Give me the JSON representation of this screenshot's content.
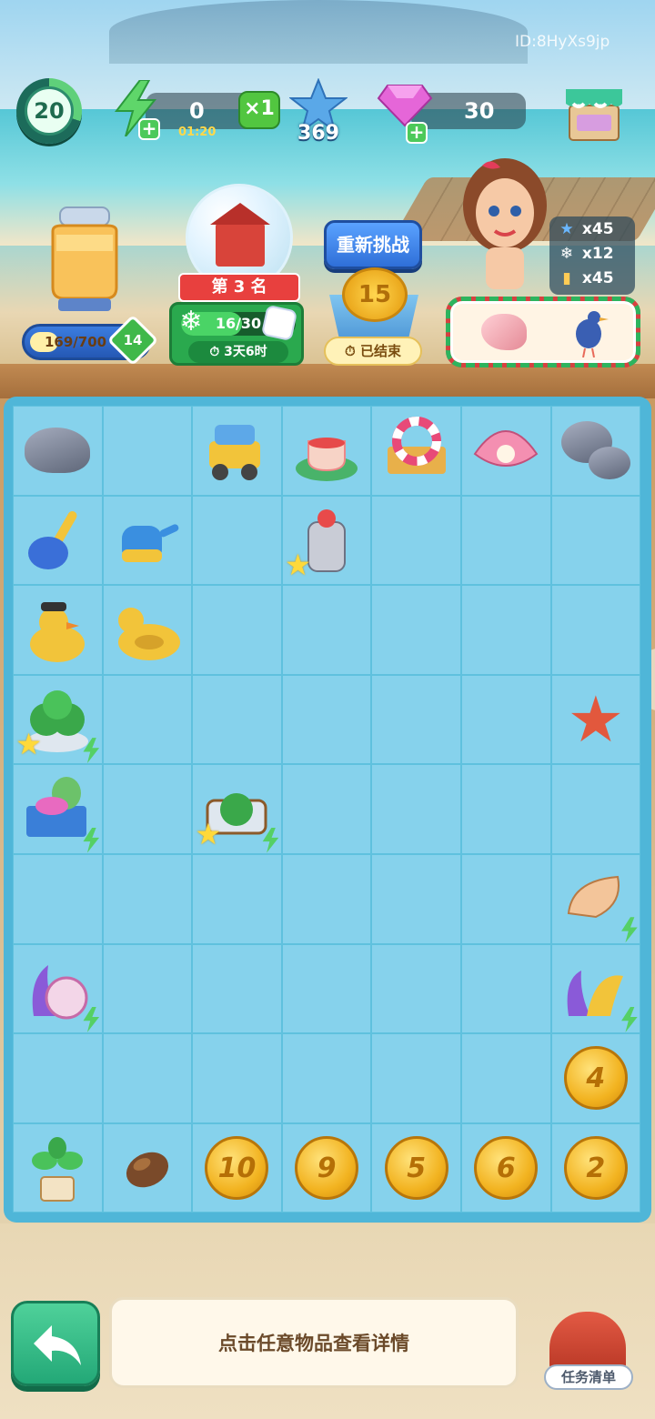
{
  "user_id": "ID:8HyXs9jp",
  "hud": {
    "level": "20",
    "energy_value": "0",
    "energy_timer": "01:20",
    "energy_multiplier": "×1",
    "stars": "369",
    "gems": "30"
  },
  "event": {
    "jar_progress": "169/700",
    "jar_progress_fraction": 0.24,
    "jar_level": "14",
    "rank_label": "第 3 名",
    "rank_progress": "16/30",
    "rank_progress_fraction": 0.53,
    "rank_timer": "3天6时",
    "retry_label": "重新挑战",
    "coin_value": "15",
    "ended_label": "已结束"
  },
  "rewards": {
    "stars": "x45",
    "snowflakes": "x12",
    "jars": "x45"
  },
  "colors": {
    "accent_green": "#2aa94e",
    "retry_blue": "#2f6fd8",
    "coin_gold": "#f2b320",
    "board_cell": "#86d2ec"
  },
  "board": {
    "rows": [
      [
        "rock-icon",
        "",
        "sand-truck-icon",
        "tea-icon",
        "life-ring-cart-icon",
        "pearl-shell-icon",
        "rocks-icon"
      ],
      [
        "shovel-icon",
        "watering-can-icon",
        "",
        "juicer-icon",
        "",
        "",
        ""
      ],
      [
        "rubber-duck-hat-icon",
        "duck-float-icon",
        "",
        "",
        "",
        "",
        ""
      ],
      [
        "cactus-pot-icon",
        "",
        "",
        "",
        "",
        "",
        "starfish-icon"
      ],
      [
        "surf-basket-icon",
        "",
        "watermelon-cart-icon",
        "",
        "",
        "",
        ""
      ],
      [
        "",
        "",
        "",
        "",
        "",
        "",
        "conch-shell-icon"
      ],
      [
        "coral-shell-icon",
        "",
        "",
        "",
        "",
        "",
        "coral-icon"
      ],
      [
        "",
        "",
        "",
        "",
        "",
        "",
        "coin-4"
      ],
      [
        "potted-plant-icon",
        "seed-icon",
        "coin-10",
        "coin-9",
        "coin-5",
        "coin-6",
        "coin-2"
      ]
    ],
    "coins": {
      "coin-4": "4",
      "coin-10": "10",
      "coin-9": "9",
      "coin-5": "5",
      "coin-6": "6",
      "coin-2": "2"
    }
  },
  "bottom": {
    "hint": "点击任意物品查看详情",
    "task_label": "任务清单"
  }
}
